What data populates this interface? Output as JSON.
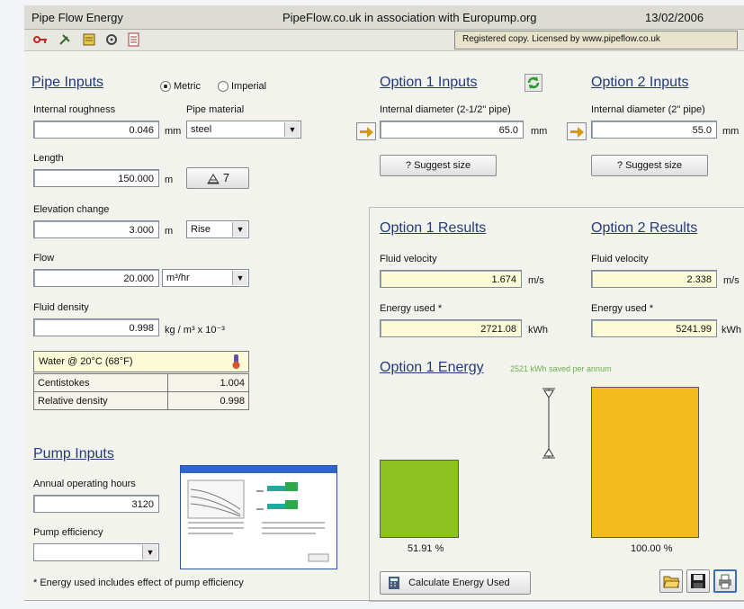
{
  "titlebar": {
    "app": "Pipe Flow Energy",
    "center": "PipeFlow.co.uk in association with Europump.org",
    "date": "13/02/2006"
  },
  "toolbar": {
    "license": "Registered copy. Licensed by www.pipeflow.co.uk"
  },
  "pipe_inputs": {
    "title": "Pipe Inputs",
    "units": {
      "metric": "Metric",
      "imperial": "Imperial",
      "selected": "metric"
    },
    "roughness": {
      "label": "Internal roughness",
      "value": "0.046",
      "unit": "mm"
    },
    "material": {
      "label": "Pipe material",
      "value": "steel"
    },
    "length": {
      "label": "Length",
      "value": "150.000",
      "unit": "m"
    },
    "fittings_button": "7",
    "elevation": {
      "label": "Elevation change",
      "value": "3.000",
      "unit": "m",
      "direction": "Rise"
    },
    "flow": {
      "label": "Flow",
      "value": "20.000",
      "unit": "m³/hr"
    },
    "density": {
      "label": "Fluid density",
      "value": "0.998",
      "unit": "kg / m³ x 10⁻³"
    },
    "fluid": {
      "name": "Water @ 20°C (68°F)",
      "rows": [
        {
          "name": "Centistokes",
          "value": "1.004"
        },
        {
          "name": "Relative density",
          "value": "0.998"
        }
      ]
    }
  },
  "pump_inputs": {
    "title": "Pump Inputs",
    "hours": {
      "label": "Annual operating hours",
      "value": "3120"
    },
    "efficiency": {
      "label": "Pump efficiency",
      "value": ""
    },
    "footnote": "* Energy used includes effect of pump efficiency"
  },
  "option1_inputs": {
    "title": "Option 1 Inputs",
    "diameter_label": "Internal diameter (2-1/2\" pipe)",
    "diameter": "65.0",
    "unit": "mm",
    "suggest": "? Suggest size"
  },
  "option2_inputs": {
    "title": "Option 2 Inputs",
    "diameter_label": "Internal diameter (2\" pipe)",
    "diameter": "55.0",
    "unit": "mm",
    "suggest": "? Suggest size"
  },
  "option1_results": {
    "title": "Option 1 Results",
    "velocity_label": "Fluid velocity",
    "velocity": "1.674",
    "velocity_unit": "m/s",
    "energy_label": "Energy used *",
    "energy": "2721.08",
    "energy_unit": "kWh"
  },
  "option2_results": {
    "title": "Option 2 Results",
    "velocity_label": "Fluid velocity",
    "velocity": "2.338",
    "velocity_unit": "m/s",
    "energy_label": "Energy used *",
    "energy": "5241.99",
    "energy_unit": "kWh"
  },
  "energy_chart": {
    "title": "Option 1 Energy",
    "saving": "2521 kWh saved per annum",
    "bar1_percent_label": "51.91 %",
    "bar2_percent_label": "100.00 %",
    "bar1_fraction": 0.5191,
    "bar2_fraction": 1.0,
    "colors": {
      "bar1": "#8cc323",
      "bar2": "#f4bb1d",
      "saving_text": "#6ab04c"
    }
  },
  "actions": {
    "calculate": "Calculate Energy Used"
  }
}
